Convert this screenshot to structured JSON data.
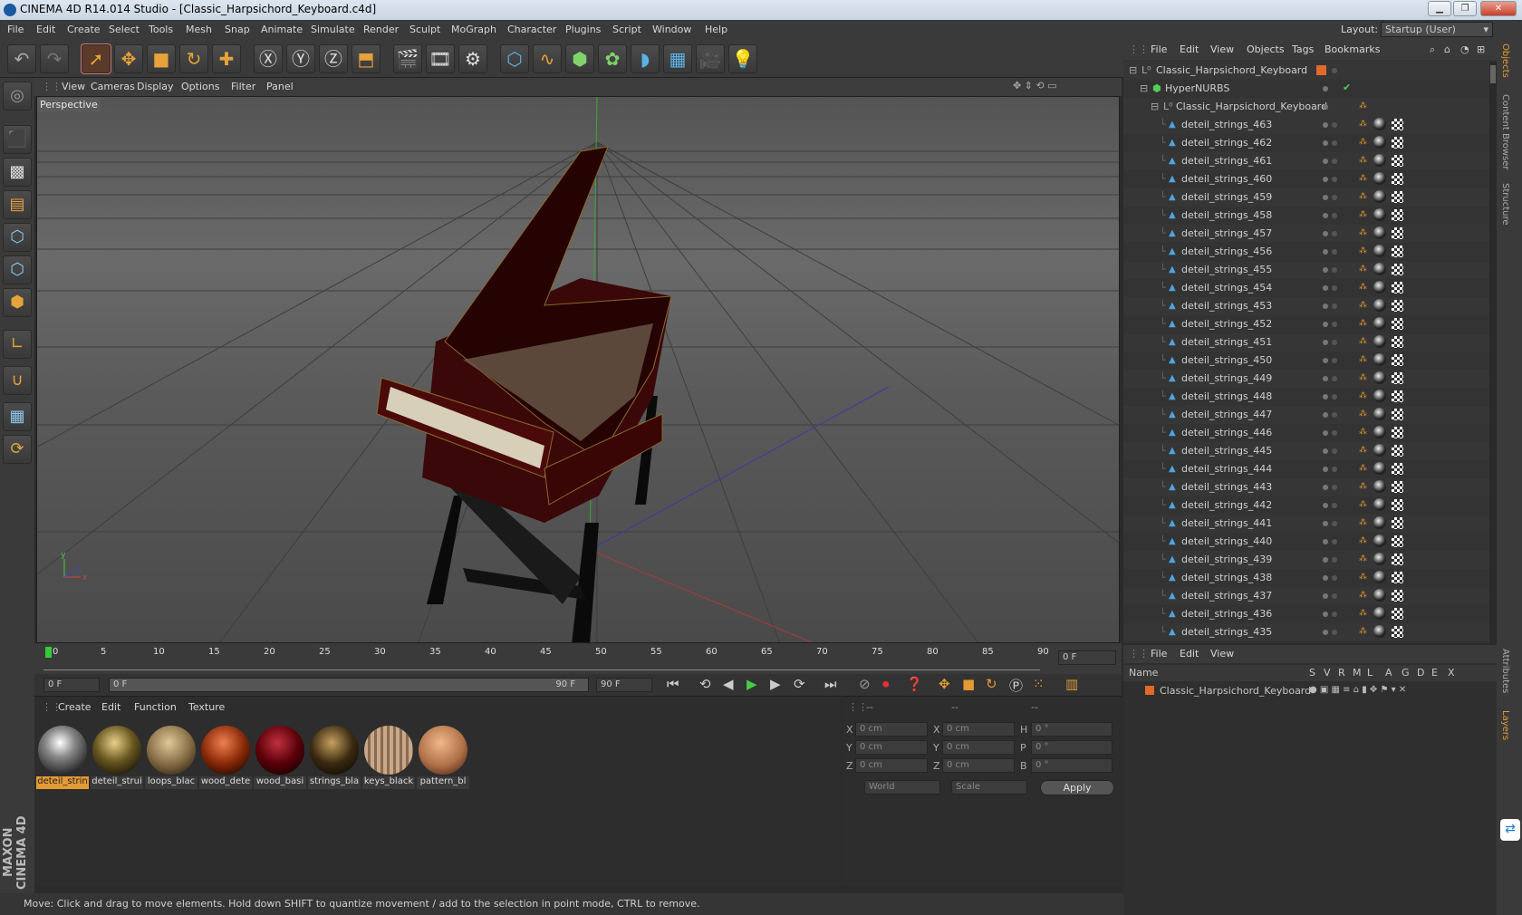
{
  "window": {
    "title": "CINEMA 4D R14.014 Studio - [Classic_Harpsichord_Keyboard.c4d]"
  },
  "menu": [
    "File",
    "Edit",
    "Create",
    "Select",
    "Tools",
    "Mesh",
    "Snap",
    "Animate",
    "Simulate",
    "Render",
    "Sculpt",
    "MoGraph",
    "Character",
    "Plugins",
    "Script",
    "Window",
    "Help"
  ],
  "layout": {
    "label": "Layout:",
    "value": "Startup (User)"
  },
  "viewport": {
    "menu": [
      "View",
      "Cameras",
      "Display",
      "Options",
      "Filter",
      "Panel"
    ],
    "label": "Perspective"
  },
  "timeline": {
    "ticks": [
      "0",
      "5",
      "10",
      "15",
      "20",
      "25",
      "30",
      "35",
      "40",
      "45",
      "50",
      "55",
      "60",
      "65",
      "70",
      "75",
      "80",
      "85",
      "90"
    ],
    "current_frame": "0 F",
    "start": "0 F",
    "range_start": "0 F",
    "range_end": "90 F",
    "end": "90 F"
  },
  "materials": {
    "menu": [
      "Create",
      "Edit",
      "Function",
      "Texture"
    ],
    "items": [
      {
        "label": "deteil_strin",
        "color": "#d8d8d8"
      },
      {
        "label": "deteil_strui",
        "color": "#a08a50"
      },
      {
        "label": "loops_blac",
        "color": "#a89068"
      },
      {
        "label": "wood_dete",
        "color": "#b05020"
      },
      {
        "label": "wood_basi",
        "color": "#6a0a10"
      },
      {
        "label": "strings_bla",
        "color": "#5a4a30"
      },
      {
        "label": "keys_black",
        "color": "#b89a78"
      },
      {
        "label": "pattern_bl",
        "color": "#c88858"
      }
    ]
  },
  "coords": {
    "headers": [
      "--",
      "--",
      "--"
    ],
    "rows": [
      {
        "a": "X",
        "v1": "0 cm",
        "b": "X",
        "v2": "0 cm",
        "c": "H",
        "v3": "0 °"
      },
      {
        "a": "Y",
        "v1": "0 cm",
        "b": "Y",
        "v2": "0 cm",
        "c": "P",
        "v3": "0 °"
      },
      {
        "a": "Z",
        "v1": "0 cm",
        "b": "Z",
        "v2": "0 cm",
        "c": "B",
        "v3": "0 °"
      }
    ],
    "world": "World",
    "scale": "Scale",
    "apply": "Apply"
  },
  "status": "Move: Click and drag to move elements. Hold down SHIFT to quantize movement / add to the selection in point mode, CTRL to remove.",
  "objects": {
    "menu": [
      "File",
      "Edit",
      "View",
      "Objects",
      "Tags",
      "Bookmarks"
    ],
    "root": "Classic_Harpsichord_Keyboard",
    "hypernurbs": "HyperNURBS",
    "child": "Classic_Harpsichord_Keyboard",
    "items": [
      "deteil_strings_463",
      "deteil_strings_462",
      "deteil_strings_461",
      "deteil_strings_460",
      "deteil_strings_459",
      "deteil_strings_458",
      "deteil_strings_457",
      "deteil_strings_456",
      "deteil_strings_455",
      "deteil_strings_454",
      "deteil_strings_453",
      "deteil_strings_452",
      "deteil_strings_451",
      "deteil_strings_450",
      "deteil_strings_449",
      "deteil_strings_448",
      "deteil_strings_447",
      "deteil_strings_446",
      "deteil_strings_445",
      "deteil_strings_444",
      "deteil_strings_443",
      "deteil_strings_442",
      "deteil_strings_441",
      "deteil_strings_440",
      "deteil_strings_439",
      "deteil_strings_438",
      "deteil_strings_437",
      "deteil_strings_436",
      "deteil_strings_435"
    ]
  },
  "layers": {
    "menu": [
      "File",
      "Edit",
      "View"
    ],
    "cols": [
      "Name",
      "S",
      "V",
      "R",
      "M",
      "L",
      "A",
      "G",
      "D",
      "E",
      "X"
    ],
    "row": "Classic_Harpsichord_Keyboard"
  },
  "side_tabs": [
    "Objects",
    "Content Browser",
    "Structure",
    "Attributes",
    "Layers"
  ],
  "brand": "MAXON CINEMA 4D"
}
